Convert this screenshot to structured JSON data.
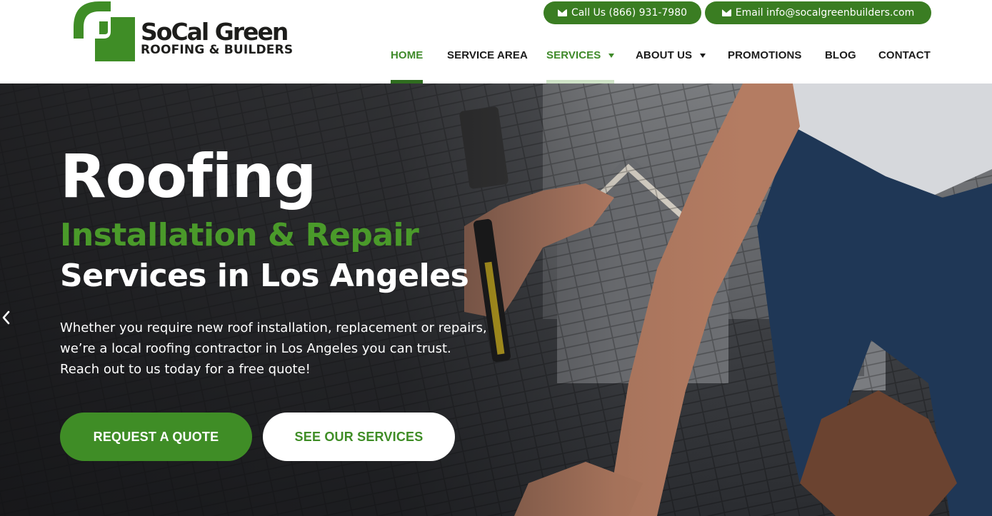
{
  "colors": {
    "brand_green": "#3a7d22",
    "accent_green": "#4a9a2a",
    "nav_text": "#1b1b1b",
    "button_green": "#3f8d26"
  },
  "brand": {
    "name": "SoCal Green",
    "tagline": "ROOFING & BUILDERS"
  },
  "contact": {
    "call_label": "Call Us (866) 931-7980",
    "call_icon": "envelope-icon",
    "email_label": "Email  info@socalgreenbuilders.com",
    "email_icon": "envelope-icon"
  },
  "nav": {
    "items": [
      {
        "label": "HOME",
        "active": true,
        "dropdown": false
      },
      {
        "label": "SERVICE AREA",
        "active": false,
        "dropdown": false
      },
      {
        "label": "SERVICES",
        "active": false,
        "highlighted": true,
        "dropdown": true
      },
      {
        "label": "ABOUT US",
        "active": false,
        "dropdown": true
      },
      {
        "label": "PROMOTIONS",
        "active": false,
        "dropdown": false
      },
      {
        "label": "BLOG",
        "active": false,
        "dropdown": false
      },
      {
        "label": "CONTACT",
        "active": false,
        "dropdown": false
      }
    ]
  },
  "hero": {
    "title": "Roofing",
    "subtitle_green": "Installation & Repair",
    "subtitle_white": "Services in Los Angeles",
    "body_lines": [
      "Whether you require new roof installation, replacement or repairs,",
      "we’re a local roofing contractor in Los Angeles you can trust.",
      "Reach out to us today for a free quote!"
    ],
    "primary_button": "REQUEST A QUOTE",
    "secondary_button": "SEE OUR SERVICES",
    "prev_arrow_icon": "chevron-left-icon"
  }
}
